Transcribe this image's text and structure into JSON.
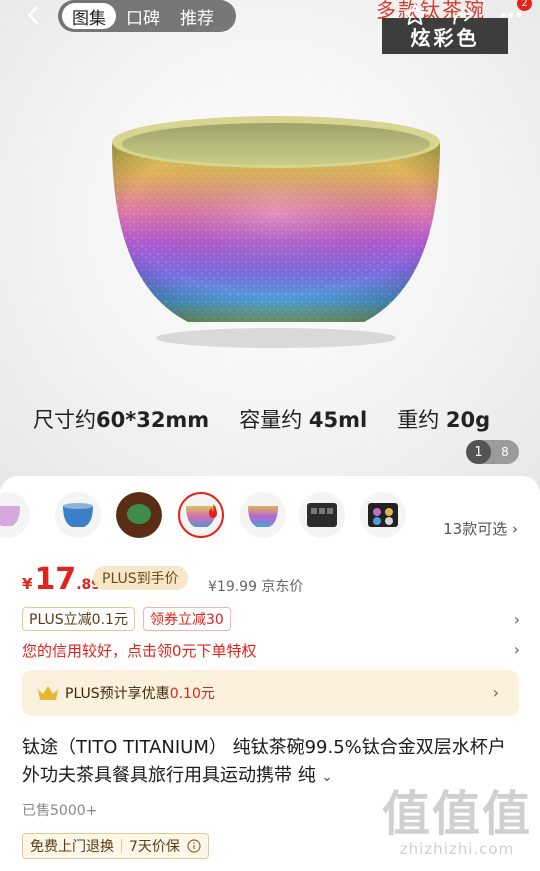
{
  "header": {
    "tabs": [
      {
        "label": "图集",
        "active": true
      },
      {
        "label": "口碑",
        "active": false
      },
      {
        "label": "推荐",
        "active": false
      }
    ],
    "cart_badge": "2",
    "banner_partial_text": "多款钛茶碗",
    "icons": [
      "back-icon",
      "star-icon",
      "share-icon",
      "more-icon"
    ]
  },
  "hero": {
    "color_tag": "炫彩色",
    "specs": {
      "size_label": "尺寸约",
      "size_value": "60*32mm",
      "volume_label": "容量约",
      "volume_value": "45ml",
      "weight_label": "重约",
      "weight_value": "20g"
    },
    "image_index": "1",
    "image_total": "8"
  },
  "variants": {
    "count_text": "13款可选 ›"
  },
  "price": {
    "currency": "¥",
    "integer": "17",
    "decimal": ".89",
    "plus_pill": "PLUS到手价",
    "jd_price": "¥19.99 京东价"
  },
  "promotions": {
    "tag_plus": "PLUS立减0.1元",
    "tag_coupon": "领券立减30",
    "credit_text": "您的信用较好，点击领0元下单特权",
    "plus_box_prefix": "PLUS预计享优惠",
    "plus_box_value": "0.10元"
  },
  "product": {
    "title": "钛途（TITO TITANIUM） 纯钛茶碗99.5%钛合金双层水杯户外功夫茶具餐具旅行用具运动携带 纯",
    "sold": "已售5000+",
    "services": [
      "免费上门退换",
      "7天价保"
    ]
  },
  "watermark": {
    "big": "值值值",
    "small": "zhizhizhi.com"
  },
  "colors": {
    "accent_red": "#e2231a",
    "plus_gold": "#f6e7c8"
  }
}
